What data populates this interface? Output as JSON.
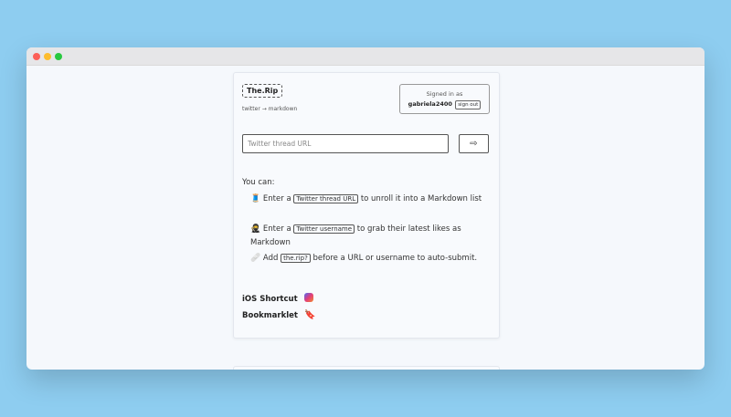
{
  "app": {
    "logo": "The.Rip",
    "tagline": "twitter → markdown"
  },
  "account": {
    "signed_in_label": "Signed in as",
    "username": "gabriela2400",
    "sign_out_label": "sign out"
  },
  "search": {
    "placeholder": "Twitter thread URL",
    "value": "",
    "submit_icon": "arrow-right-icon",
    "submit_glyph": "⇨"
  },
  "instructions": {
    "heading": "You can:",
    "items": [
      {
        "icon": "🧵",
        "icon_name": "thread-icon",
        "before": "Enter a",
        "code": "Twitter thread URL",
        "after": "to unroll it into a Markdown list"
      },
      {
        "icon": "🥷",
        "icon_name": "ninja-icon",
        "before": "Enter a",
        "code": "Twitter username",
        "after": "to grab their latest likes as Markdown"
      },
      {
        "icon": "🩹",
        "icon_name": "bandage-icon",
        "before": "Add",
        "code": "the.rip?",
        "after": "before a URL or username to auto-submit."
      }
    ]
  },
  "links": {
    "ios_shortcut": "iOS Shortcut",
    "bookmarklet": "Bookmarklet",
    "bookmarklet_icon": "🔖"
  }
}
